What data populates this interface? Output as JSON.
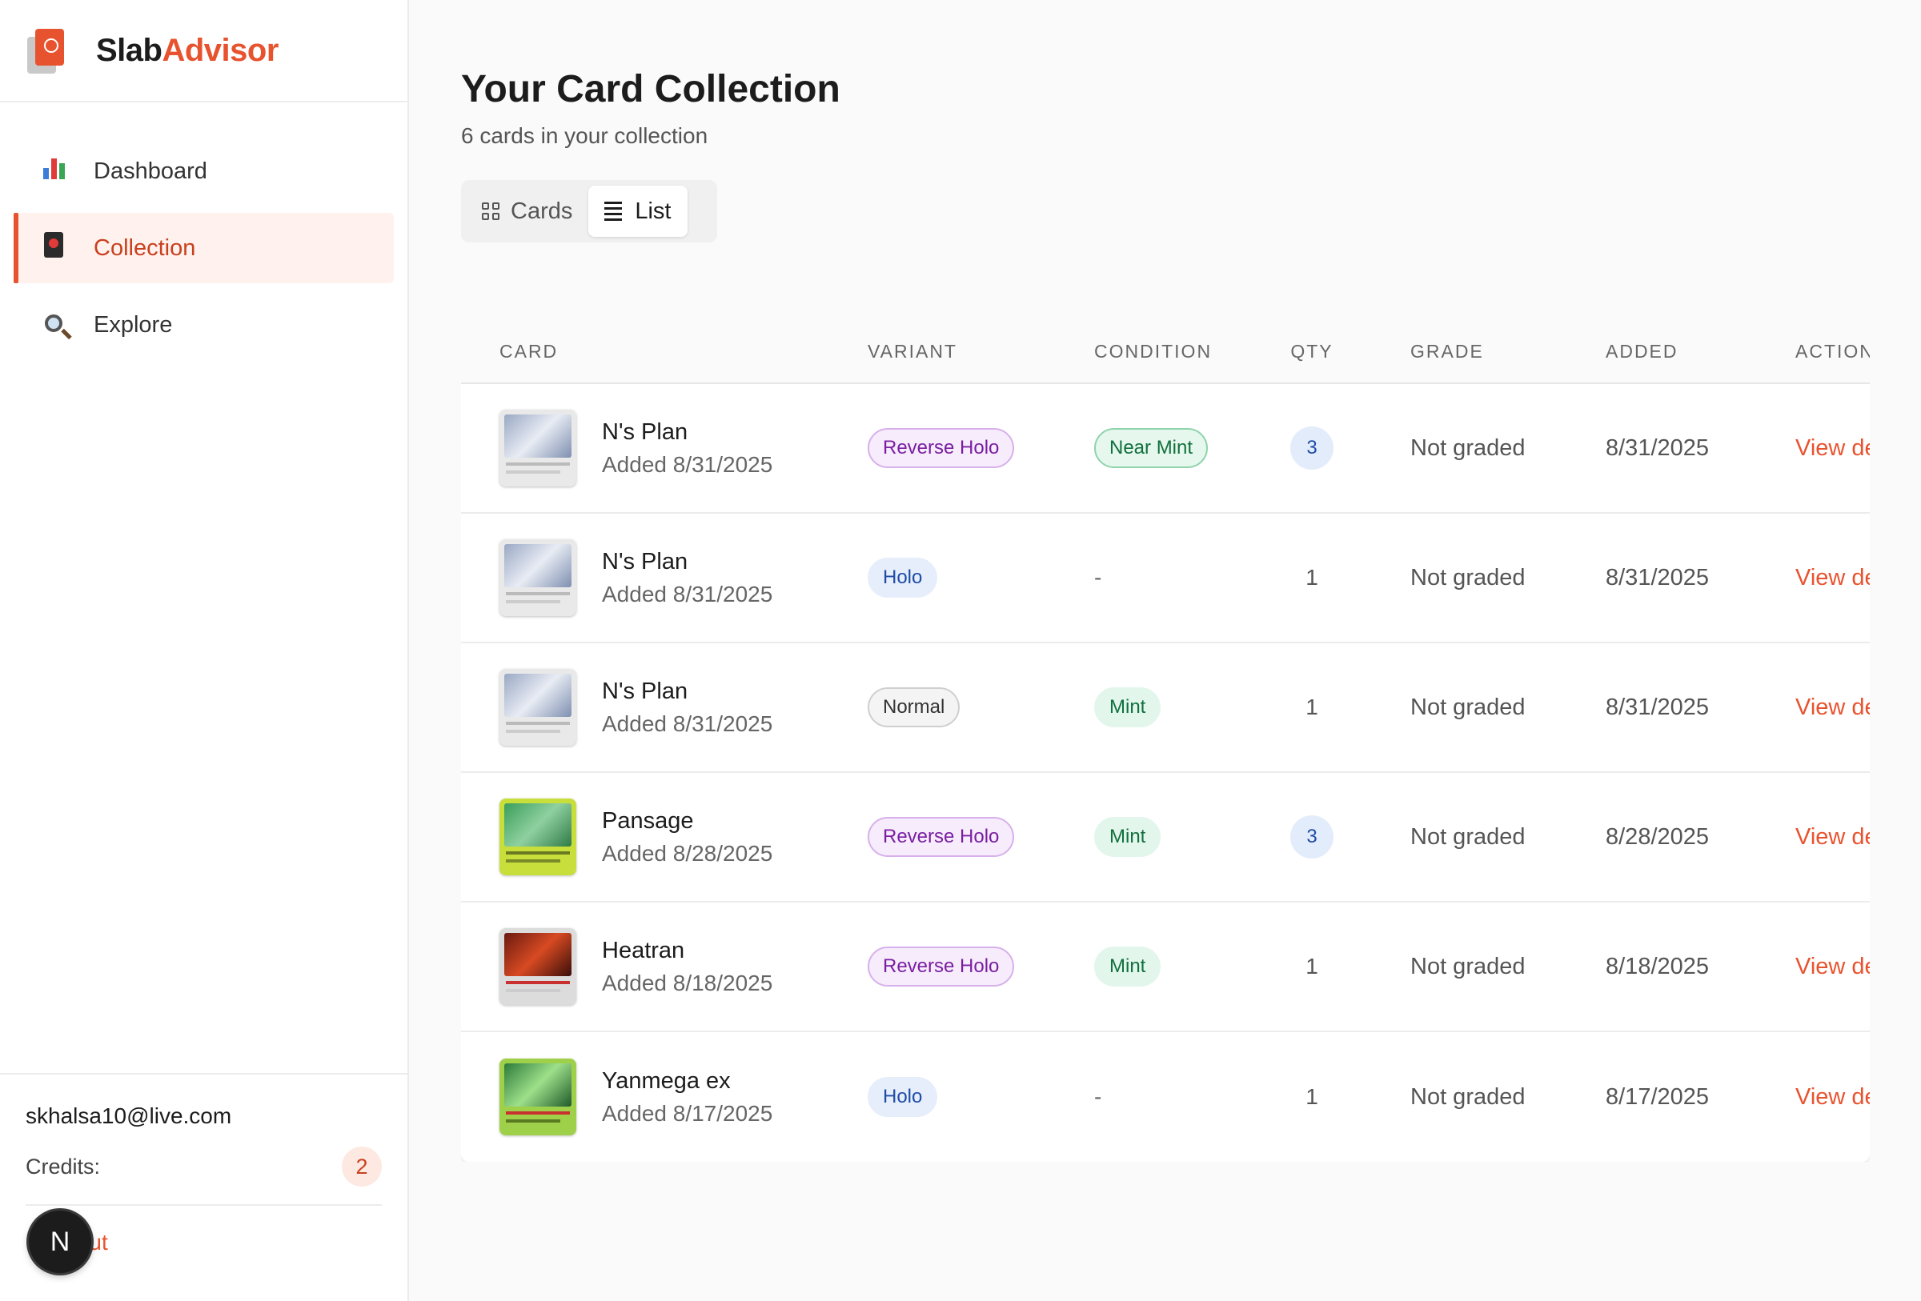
{
  "brand": {
    "part1": "Slab",
    "part2": "Advisor"
  },
  "nav": [
    {
      "label": "Dashboard",
      "icon": "bar-chart-icon"
    },
    {
      "label": "Collection",
      "icon": "card-icon",
      "active": true
    },
    {
      "label": "Explore",
      "icon": "magnifier-icon"
    }
  ],
  "account": {
    "email": "skhalsa10@live.com",
    "credits_label": "Credits:",
    "credits": "2",
    "signout": "Sign out",
    "avatar_letter": "N"
  },
  "page": {
    "title": "Your Card Collection",
    "subtitle": "6 cards in your collection"
  },
  "view_toggle": {
    "cards_label": "Cards",
    "list_label": "List",
    "active": "List"
  },
  "table": {
    "headers": [
      "CARD",
      "VARIANT",
      "CONDITION",
      "QTY",
      "GRADE",
      "ADDED",
      "ACTIONS"
    ],
    "rows": [
      {
        "name": "N's Plan",
        "added_sub": "Added 8/31/2025",
        "variant": "Reverse Holo",
        "condition": "Near Mint",
        "qty": "3",
        "grade": "Not graded",
        "added": "8/31/2025",
        "action": "View details"
      },
      {
        "name": "N's Plan",
        "added_sub": "Added 8/31/2025",
        "variant": "Holo",
        "condition": "-",
        "qty": "1",
        "grade": "Not graded",
        "added": "8/31/2025",
        "action": "View details"
      },
      {
        "name": "N's Plan",
        "added_sub": "Added 8/31/2025",
        "variant": "Normal",
        "condition": "Mint",
        "qty": "1",
        "grade": "Not graded",
        "added": "8/31/2025",
        "action": "View details"
      },
      {
        "name": "Pansage",
        "added_sub": "Added 8/28/2025",
        "variant": "Reverse Holo",
        "condition": "Mint",
        "qty": "3",
        "grade": "Not graded",
        "added": "8/28/2025",
        "action": "View details"
      },
      {
        "name": "Heatran",
        "added_sub": "Added 8/18/2025",
        "variant": "Reverse Holo",
        "condition": "Mint",
        "qty": "1",
        "grade": "Not graded",
        "added": "8/18/2025",
        "action": "View details"
      },
      {
        "name": "Yanmega ex",
        "added_sub": "Added 8/17/2025",
        "variant": "Holo",
        "condition": "-",
        "qty": "1",
        "grade": "Not graded",
        "added": "8/17/2025",
        "action": "View details"
      }
    ]
  },
  "colors": {
    "accent": "#e8532f",
    "sidebar_active_bg": "#fff1ed"
  }
}
